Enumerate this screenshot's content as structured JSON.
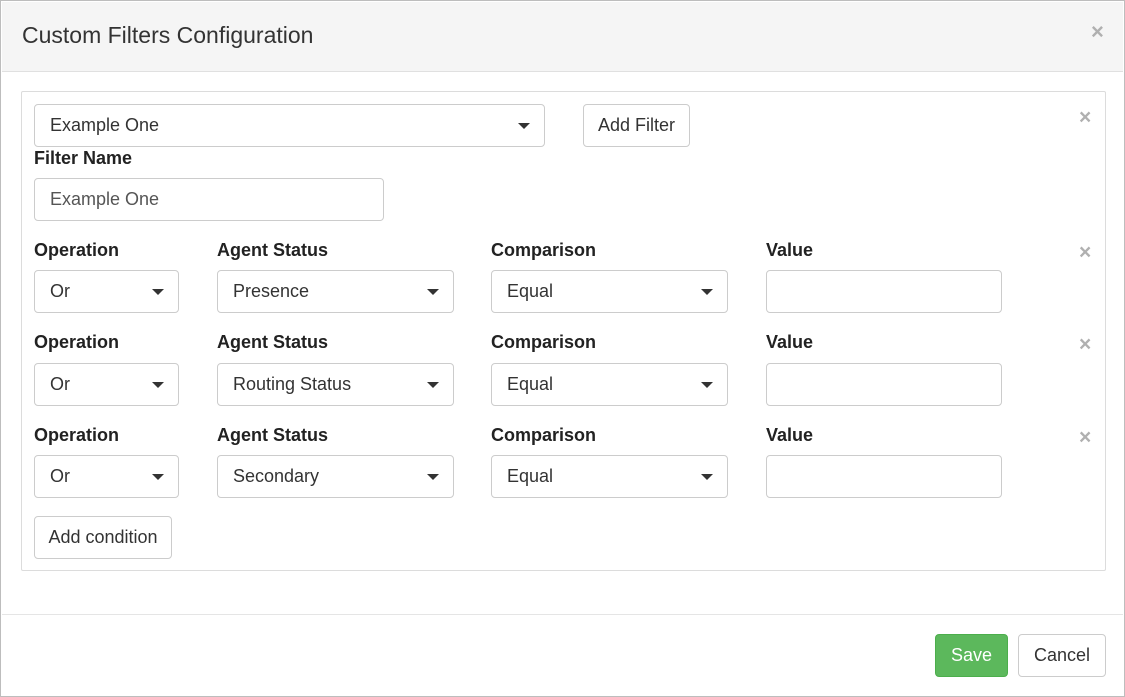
{
  "modal": {
    "title": "Custom Filters Configuration",
    "close_icon": "×"
  },
  "filter": {
    "selected": "Example One",
    "add_filter_label": "Add Filter",
    "remove_icon": "×",
    "name_label": "Filter Name",
    "name_value": "Example One"
  },
  "columns": {
    "operation": "Operation",
    "agent_status": "Agent Status",
    "comparison": "Comparison",
    "value": "Value"
  },
  "conditions": [
    {
      "operation": "Or",
      "agent_status": "Presence",
      "comparison": "Equal",
      "value": "",
      "remove_icon": "×"
    },
    {
      "operation": "Or",
      "agent_status": "Routing Status",
      "comparison": "Equal",
      "value": "",
      "remove_icon": "×"
    },
    {
      "operation": "Or",
      "agent_status": "Secondary",
      "comparison": "Equal",
      "value": "",
      "remove_icon": "×"
    }
  ],
  "add_condition_label": "Add condition",
  "footer": {
    "save_label": "Save",
    "cancel_label": "Cancel"
  },
  "colors": {
    "save_button": "#5cb85c",
    "header_bg": "#f5f5f5"
  }
}
